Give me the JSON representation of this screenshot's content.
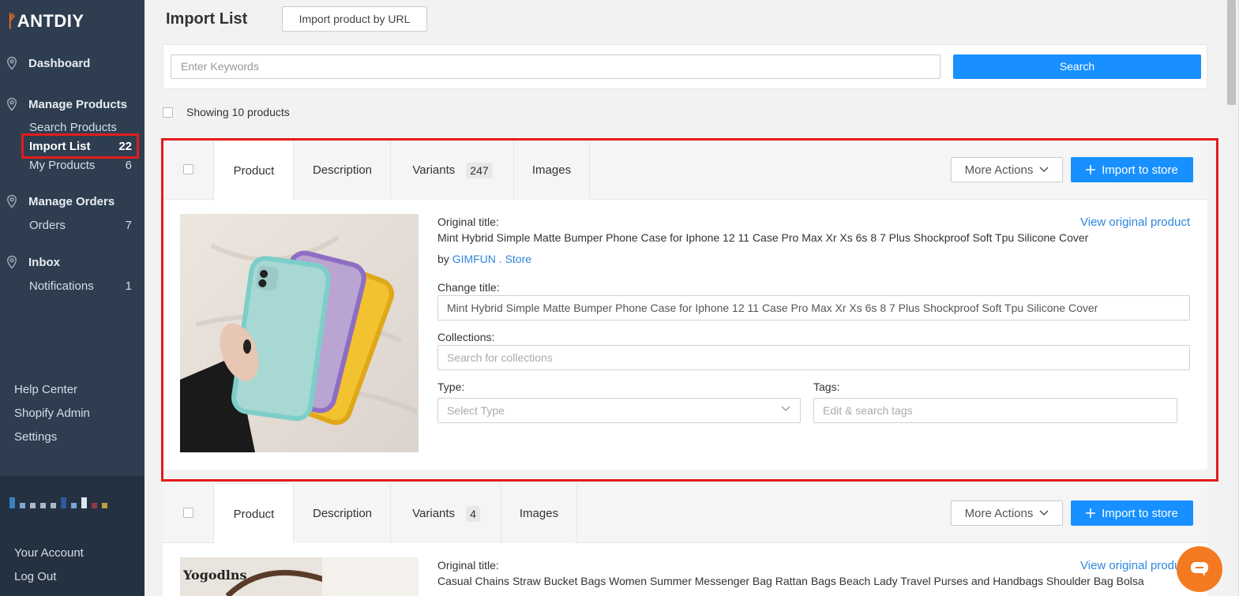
{
  "brand": {
    "name": "ANTDIY",
    "accent": "#f26b21"
  },
  "sidebar": {
    "groups": [
      {
        "label": "Dashboard",
        "icon": "location-pin-icon",
        "items": []
      },
      {
        "label": "Manage Products",
        "icon": "location-pin-icon",
        "items": [
          {
            "label": "Search Products",
            "count": ""
          },
          {
            "label": "Import List",
            "count": "22",
            "active": true
          },
          {
            "label": "My Products",
            "count": "6"
          }
        ]
      },
      {
        "label": "Manage Orders",
        "icon": "location-pin-icon",
        "items": [
          {
            "label": "Orders",
            "count": "7"
          }
        ]
      },
      {
        "label": "Inbox",
        "icon": "location-pin-icon",
        "items": [
          {
            "label": "Notifications",
            "count": "1"
          }
        ]
      }
    ],
    "links": [
      "Help Center",
      "Shopify Admin",
      "Settings"
    ],
    "account_links": [
      "Your Account",
      "Log Out"
    ]
  },
  "header": {
    "title": "Import List",
    "import_by_url_label": "Import product by URL"
  },
  "search": {
    "placeholder": "Enter Keywords",
    "button_label": "Search"
  },
  "showing_label": "Showing 10 products",
  "products": [
    {
      "tabs": {
        "product": "Product",
        "description": "Description",
        "variants": "Variants",
        "variants_count": "247",
        "images": "Images"
      },
      "more_actions": "More Actions",
      "import_label": "Import to store",
      "original_title_label": "Original title:",
      "view_original": "View original product",
      "original_title": "Mint Hybrid Simple Matte Bumper Phone Case for Iphone 12 11 Case Pro Max Xr Xs 6s 8 7 Plus Shockproof Soft Tpu Silicone Cover",
      "by_label": "by",
      "store_name": "GIMFUN . Store",
      "change_title_label": "Change title:",
      "change_title_value": "Mint Hybrid Simple Matte Bumper Phone Case for Iphone 12 11 Case Pro Max Xr Xs 6s 8 7 Plus Shockproof Soft Tpu Silicone Cover",
      "collections_label": "Collections:",
      "collections_placeholder": "Search for collections",
      "type_label": "Type:",
      "type_placeholder": "Select Type",
      "tags_label": "Tags:",
      "tags_placeholder": "Edit & search tags"
    },
    {
      "tabs": {
        "product": "Product",
        "description": "Description",
        "variants": "Variants",
        "variants_count": "4",
        "images": "Images"
      },
      "more_actions": "More Actions",
      "import_label": "Import to store",
      "original_title_label": "Original title:",
      "view_original": "View original product",
      "original_title": "Casual Chains Straw Bucket Bags Women Summer Messenger Bag Rattan Bags Beach Lady Travel Purses and Handbags Shoulder Bag Bolsa",
      "image_text": "Yogodlns"
    }
  ],
  "colors": {
    "sidebar": "#2e3e50",
    "primary": "#1890ff",
    "highlight": "#e31c1c",
    "chat": "#f47920"
  }
}
